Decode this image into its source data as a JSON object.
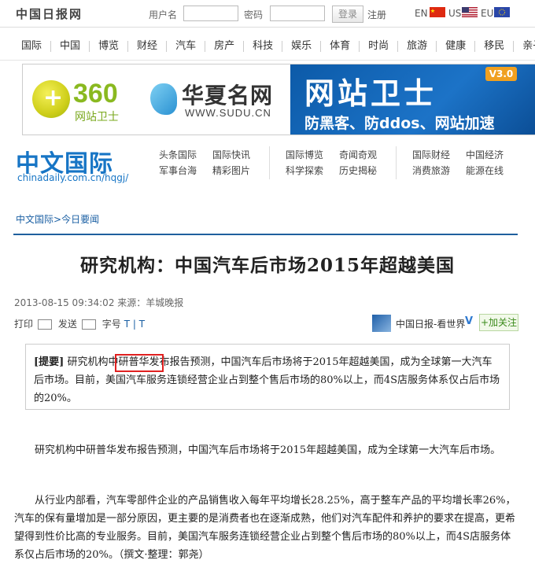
{
  "top": {
    "logo": "中国日报网",
    "username_label": "用户名",
    "password_label": "密码",
    "login_btn": "登录",
    "register": "注册",
    "langs": [
      {
        "code": "EN",
        "flag": "cn-flag-icon"
      },
      {
        "code": "US",
        "flag": "us-flag-icon"
      },
      {
        "code": "EU",
        "flag": "eu-flag-icon"
      }
    ]
  },
  "nav": [
    "国际",
    "中国",
    "博览",
    "财经",
    "汽车",
    "房产",
    "科技",
    "娱乐",
    "体育",
    "时尚",
    "旅游",
    "健康",
    "移民",
    "亲子"
  ],
  "banner": {
    "brand1_num": "360",
    "brand1_sub": "网站卫士",
    "brand2_title": "华夏名网",
    "brand2_url": "WWW.SUDU.CN",
    "guard_title": "网站卫士",
    "guard_version": "V3.0",
    "guard_sub": "防黑客、防ddos、网站加速"
  },
  "subheader": {
    "brand": "中文国际",
    "url": "chinadaily.com.cn/hqgj/",
    "col1": [
      "头条国际",
      "军事台海"
    ],
    "col2": [
      "国际快讯",
      "精彩图片"
    ],
    "col3": [
      "国际博览",
      "科学探索"
    ],
    "col4": [
      "奇闻奇观",
      "历史揭秘"
    ],
    "col5": [
      "国际财经",
      "消费旅游"
    ],
    "col6": [
      "中国经济",
      "能源在线"
    ]
  },
  "breadcrumb": {
    "root": "中文国际",
    "sep": ">",
    "current": "今日要闻"
  },
  "article": {
    "title": "研究机构：中国汽车后市场2015年超越美国",
    "meta": "2013-08-15 09:34:02 来源：羊城晚报",
    "tools": {
      "print": "打印",
      "send": "发送",
      "font": "字号",
      "font_t": "T | T"
    },
    "follow": {
      "name": "中国日报-看世界",
      "v": "V",
      "btn": "+加关注"
    },
    "summary_tag": "[提要]",
    "summary_text": "研究机构中研普华发布报告预测，中国汽车后市场将于2015年超越美国，成为全球第一大汽车后市场。目前，美国汽车服务连锁经营企业占到整个售后市场的80%以上，而4S店服务体系仅占后市场的20%。",
    "para1": "研究机构中研普华发布报告预测，中国汽车后市场将于2015年超越美国，成为全球第一大汽车后市场。",
    "para2": "从行业内部看，汽车零部件企业的产品销售收入每年平均增长28.25%，高于整车产品的平均增长率26%，汽车的保有量增加是一部分原因，更主要的是消费者也在逐渐成熟，他们对汽车配件和养护的要求在提高，更希望得到性价比高的专业服务。目前，美国汽车服务连锁经营企业占到整个售后市场的80%以上，而4S店服务体系仅占后市场的20%。（撰文·整理：郭尧）"
  },
  "colors": {
    "accent": "#1775c5",
    "rule": "#1f5f9e",
    "highlight": "#e02020"
  }
}
